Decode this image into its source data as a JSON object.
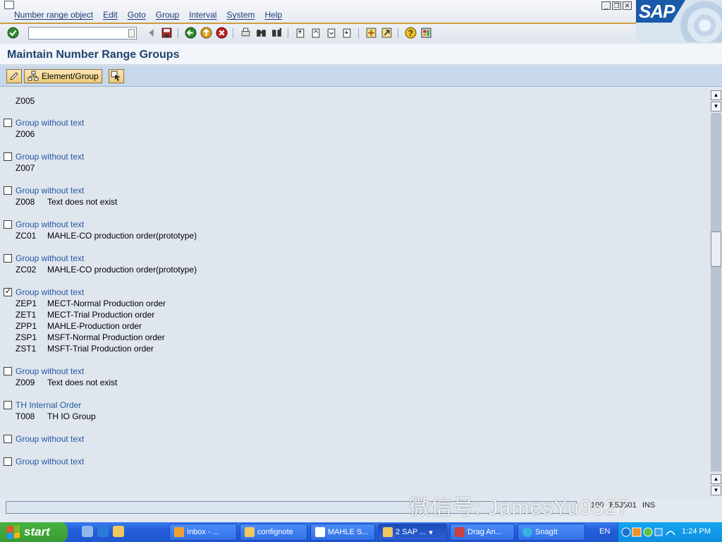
{
  "menu": {
    "items": [
      "Number range object",
      "Edit",
      "Goto",
      "Group",
      "Interval",
      "System",
      "Help"
    ]
  },
  "sap_logo": "SAP",
  "screen_title": "Maintain Number Range Groups",
  "app_toolbar": {
    "element_group_label": "Element/Group"
  },
  "content": {
    "first_element": {
      "code": "Z005",
      "text": ""
    },
    "groups": [
      {
        "label": "Group without text",
        "checked": false,
        "elements": [
          {
            "code": "Z006",
            "text": ""
          }
        ]
      },
      {
        "label": "Group without text",
        "checked": false,
        "elements": [
          {
            "code": "Z007",
            "text": ""
          }
        ]
      },
      {
        "label": "Group without text",
        "checked": false,
        "elements": [
          {
            "code": "Z008",
            "text": "Text does not exist"
          }
        ]
      },
      {
        "label": "Group without text",
        "checked": false,
        "elements": [
          {
            "code": "ZC01",
            "text": "MAHLE-CO production order(prototype)"
          }
        ]
      },
      {
        "label": "Group without text",
        "checked": false,
        "elements": [
          {
            "code": "ZC02",
            "text": "MAHLE-CO production order(prototype)"
          }
        ]
      },
      {
        "label": "Group without text",
        "checked": true,
        "elements": [
          {
            "code": "ZEP1",
            "text": "MECT-Normal Production order"
          },
          {
            "code": "ZET1",
            "text": "MECT-Trial Production order"
          },
          {
            "code": "ZPP1",
            "text": "MAHLE-Production order"
          },
          {
            "code": "ZSP1",
            "text": "MSFT-Normal Production order"
          },
          {
            "code": "ZST1",
            "text": "MSFT-Trial Production order"
          }
        ]
      },
      {
        "label": "Group without text",
        "checked": false,
        "elements": [
          {
            "code": "Z009",
            "text": "Text does not exist"
          }
        ]
      },
      {
        "label": "TH Internal Order",
        "checked": false,
        "elements": [
          {
            "code": "T008",
            "text": "TH IO Group"
          }
        ]
      },
      {
        "label": "Group without text",
        "checked": false,
        "elements": []
      },
      {
        "label": "Group without text",
        "checked": false,
        "elements": []
      }
    ]
  },
  "status_bar": {
    "client": "100",
    "server": "E5JS01",
    "mode": "INS"
  },
  "watermark": "微信号: JamesYu9527",
  "taskbar": {
    "start_label": "start",
    "tasks": [
      "Inbox - ...",
      "confignote",
      "MAHLE S...",
      "2 SAP ...",
      "Drag An...",
      "SnagIt"
    ],
    "language": "EN",
    "clock": "1:24 PM"
  },
  "colors": {
    "group_link": "#2559a6",
    "title_text": "#1f4470",
    "toolbar_accent": "#d19a3c",
    "taskbar_blue": "#245edb",
    "start_green": "#3a9a33"
  }
}
